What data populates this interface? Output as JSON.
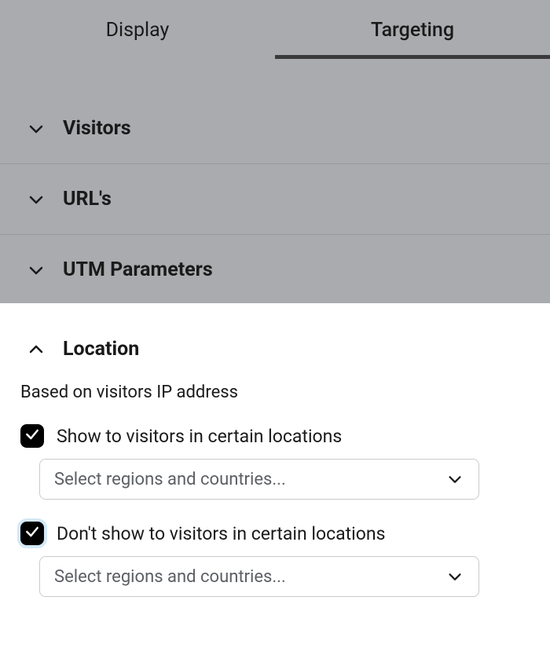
{
  "tabs": {
    "display": "Display",
    "targeting": "Targeting"
  },
  "sections": {
    "visitors": "Visitors",
    "urls": "URL's",
    "utm": "UTM Parameters",
    "location": "Location"
  },
  "location": {
    "subtext": "Based on visitors IP address",
    "show_label": "Show to visitors in certain locations",
    "dontshow_label": "Don't show to visitors in certain locations",
    "show_placeholder": "Select regions and countries...",
    "dontshow_placeholder": "Select regions and countries..."
  }
}
